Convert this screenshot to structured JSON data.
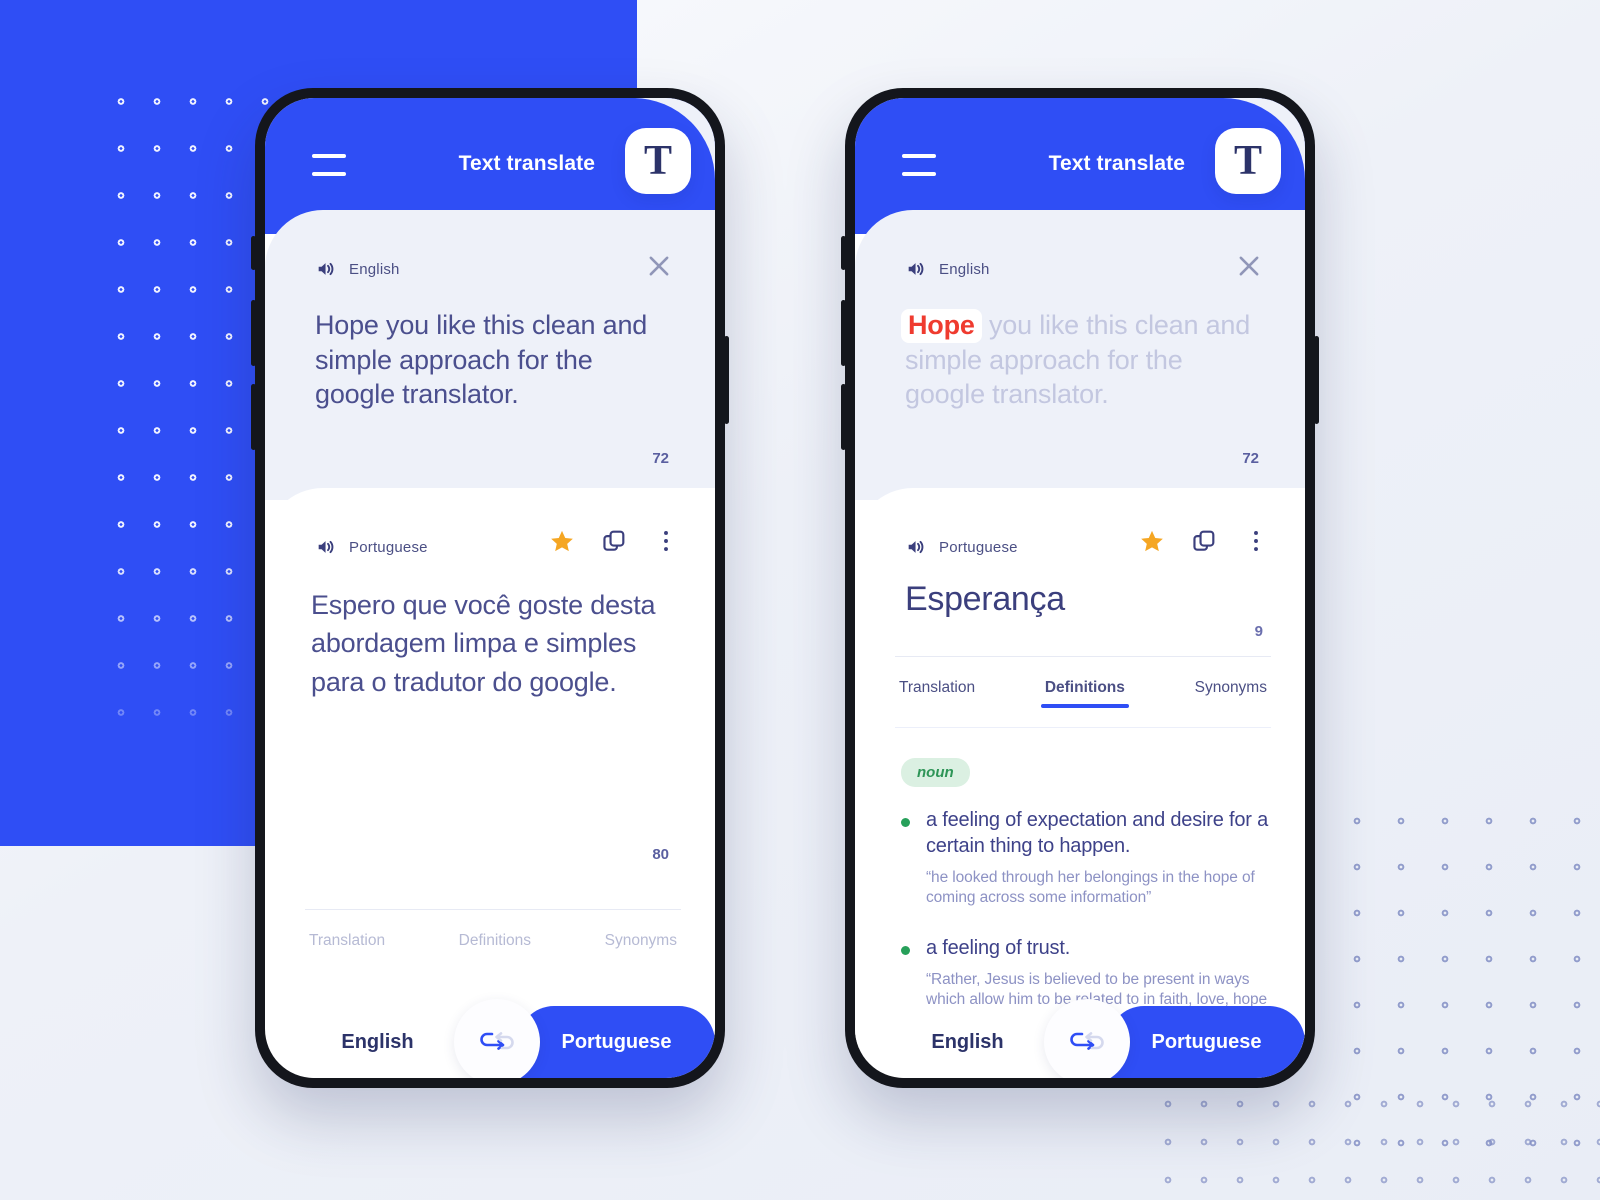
{
  "app": {
    "header_title": "Text translate",
    "logo_letter": "T",
    "menu_icon": "hamburger-menu-icon",
    "accent_blue": "#2f4ef5",
    "text_navy": "#3e4289",
    "star_orange": "#f5a623",
    "highlight_red": "#ef3b2f",
    "badge_green": "#2e9557"
  },
  "phone1": {
    "source": {
      "lang": "English",
      "text": "Hope you like this clean and simple approach for the google translator.",
      "char_count": "72",
      "close_label": "close-icon"
    },
    "target": {
      "lang": "Portuguese",
      "text": "Espero que você goste desta abordagem limpa e simples para o tradutor do google.",
      "char_count": "80"
    },
    "tabs": [
      {
        "label": "Translation",
        "active": false
      },
      {
        "label": "Definitions",
        "active": false
      },
      {
        "label": "Synonyms",
        "active": false
      }
    ],
    "lang_bar": {
      "from": "English",
      "to": "Portuguese",
      "swap_icon": "swap-arrows-icon"
    }
  },
  "phone2": {
    "source": {
      "lang": "English",
      "highlight": "Hope",
      "rest": " you like this clean and simple approach for the google translator.",
      "char_count": "72"
    },
    "target": {
      "lang": "Portuguese",
      "word": "Esperança",
      "char_count": "9"
    },
    "tabs": [
      {
        "label": "Translation",
        "active": false
      },
      {
        "label": "Definitions",
        "active": true
      },
      {
        "label": "Synonyms",
        "active": false
      }
    ],
    "definitions": {
      "part_of_speech": "noun",
      "items": [
        {
          "meaning": "a feeling of expectation and desire for a certain thing to happen.",
          "example": "“he looked through her belongings in the hope of coming across some information”"
        },
        {
          "meaning": "a feeling of trust.",
          "example": "“Rather, Jesus is believed to be present in ways which allow him to be related to in faith, love, hope , joy, and obedience.”"
        }
      ]
    },
    "lang_bar": {
      "from": "English",
      "to": "Portuguese",
      "swap_icon": "swap-arrows-icon"
    }
  }
}
